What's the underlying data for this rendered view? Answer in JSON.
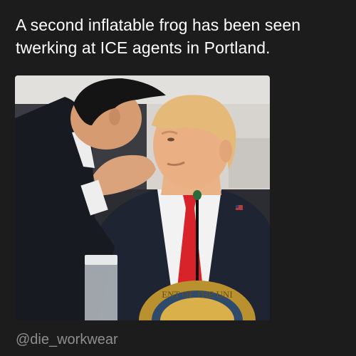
{
  "post": {
    "caption": "A second inflatable frog has been seen twerking at ICE agents in Portland.",
    "handle": "@die_workwear"
  },
  "colors": {
    "background": "#1c1c1c",
    "caption_text": "#ffffff",
    "handle_text": "#8e8e8e",
    "tie": "#d8232a",
    "suit_dark": "#1c1f2b",
    "seal_gold": "#b9912e"
  },
  "photo": {
    "seal_text": "ENT OF THE UNI"
  }
}
